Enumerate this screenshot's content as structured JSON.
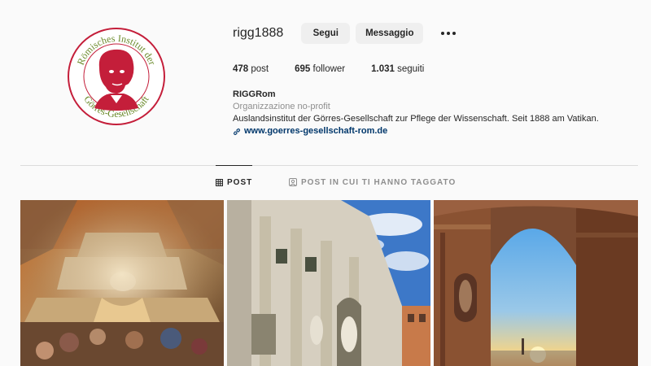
{
  "profile": {
    "username": "rigg1888",
    "follow_label": "Segui",
    "message_label": "Messaggio",
    "stats": [
      {
        "count": "478",
        "label": " post"
      },
      {
        "count": "695",
        "label": " follower"
      },
      {
        "count": "1.031",
        "label": " seguiti"
      }
    ],
    "name": "RIGGRom",
    "category": "Organizzazione no-profit",
    "bio": "Auslandsinstitut der Görres-Gesellschaft zur Pflege der Wissenschaft. Seit 1888 am Vatikan.",
    "link": "www.goerres-gesellschaft-rom.de"
  },
  "logo": {
    "text_top": "Römisches Institut der",
    "text_bottom": "Görres-Gesellschaft",
    "ring_color": "#c41e3a",
    "text_color": "#6a8a2a",
    "portrait_color": "#c41e3a"
  },
  "tabs": [
    {
      "label": "POST",
      "icon": "grid-icon",
      "active": true
    },
    {
      "label": "POST IN CUI TI HANNO TAGGATO",
      "icon": "tagged-icon",
      "active": false
    }
  ],
  "posts": [
    {
      "subject": "baroque-ceiling-fresco"
    },
    {
      "subject": "trevi-fountain"
    },
    {
      "subject": "arch-sunset-view"
    }
  ]
}
